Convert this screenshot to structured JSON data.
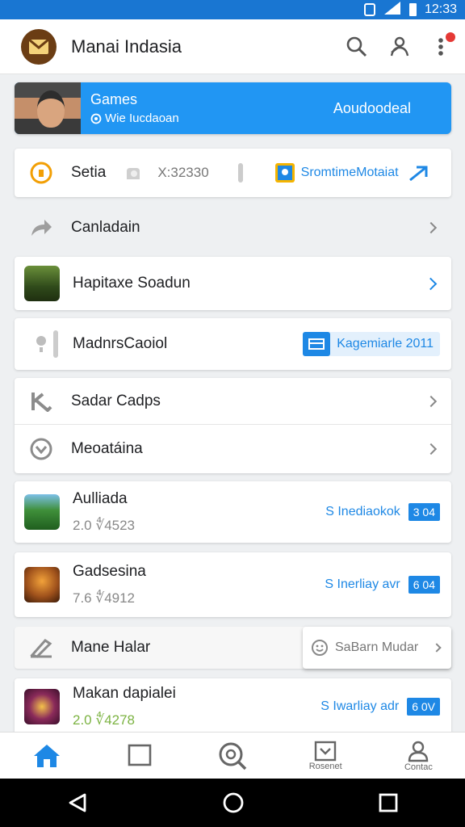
{
  "status": {
    "time": "12:33"
  },
  "app": {
    "title": "Manai Indasia"
  },
  "banner": {
    "title": "Games",
    "subtitle": "Wie Iucdaoan",
    "action": "Aoudoodeal"
  },
  "card_settings": {
    "label": "Setia",
    "value": "X:32330",
    "link": "SromtimeMotaiat"
  },
  "row_canladain": {
    "label": "Canladain"
  },
  "card_hapitaxe": {
    "label": "Hapitaxe Soadun"
  },
  "card_madnrs": {
    "label": "MadnrsCaoiol",
    "badge": "Kagemiarle 2011"
  },
  "group": {
    "item1": "Sadar Cadps",
    "item2": "Meoatáina"
  },
  "app_items": [
    {
      "title": "Aulliada",
      "meta": "2.0 ∜4523",
      "link": "S Inediaokok",
      "badge": "3 04"
    },
    {
      "title": "Gadsesina",
      "meta": "7.6 ∜4912",
      "link": "S Inerliay avr",
      "badge": "6 04"
    },
    {
      "title": "Makan dapialei",
      "meta": "2.0 ∜4278",
      "link": "S Iwarliay adr",
      "badge": "6 0V"
    }
  ],
  "row_mane": {
    "label": "Mane Halar",
    "popup": "SaBarn Mudar"
  },
  "bottom_nav": {
    "recent": "Rosenet",
    "contact": "Contac"
  },
  "colors": {
    "primary": "#1e88e5",
    "status_bar": "#1976d2"
  }
}
